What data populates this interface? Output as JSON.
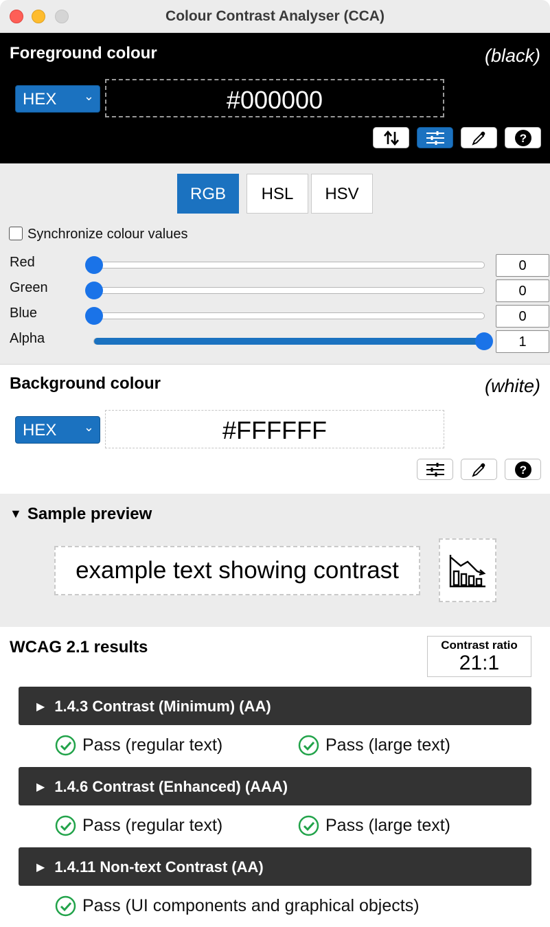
{
  "window": {
    "title": "Colour Contrast Analyser (CCA)"
  },
  "foreground": {
    "heading": "Foreground colour",
    "name": "(black)",
    "format": "HEX",
    "hex_value": "#000000",
    "tools": [
      "swap-icon",
      "sliders-icon",
      "eyedropper-icon",
      "help-icon"
    ]
  },
  "color_modes": {
    "rgb": "RGB",
    "hsl": "HSL",
    "hsv": "HSV",
    "active": "RGB"
  },
  "sync": {
    "label": "Synchronize colour values",
    "checked": false
  },
  "channels": [
    {
      "label": "Red",
      "value": "0",
      "level": 0
    },
    {
      "label": "Green",
      "value": "0",
      "level": 0
    },
    {
      "label": "Blue",
      "value": "0",
      "level": 0
    },
    {
      "label": "Alpha",
      "value": "1",
      "level": 1
    }
  ],
  "background": {
    "heading": "Background colour",
    "name": "(white)",
    "format": "HEX",
    "hex_value": "#FFFFFF",
    "tools": [
      "sliders-icon",
      "eyedropper-icon",
      "help-icon"
    ]
  },
  "preview": {
    "heading": "Sample preview",
    "sample_text": "example text showing contrast",
    "icon": "chart-decrease-icon"
  },
  "results": {
    "heading": "WCAG 2.1 results",
    "ratio_label": "Contrast ratio",
    "ratio_value": "21:1",
    "criteria": [
      {
        "title": "1.4.3 Contrast (Minimum) (AA)",
        "outcomes": [
          "Pass (regular text)",
          "Pass (large text)"
        ]
      },
      {
        "title": "1.4.6 Contrast (Enhanced) (AAA)",
        "outcomes": [
          "Pass (regular text)",
          "Pass (large text)"
        ]
      },
      {
        "title": "1.4.11 Non-text Contrast (AA)",
        "outcomes": [
          "Pass (UI components and graphical objects)"
        ]
      }
    ]
  },
  "colors": {
    "accent": "#1b72c0",
    "slider_thumb": "#1a73e8",
    "pass_green": "#22a34a",
    "criterion_bg": "#333333"
  }
}
